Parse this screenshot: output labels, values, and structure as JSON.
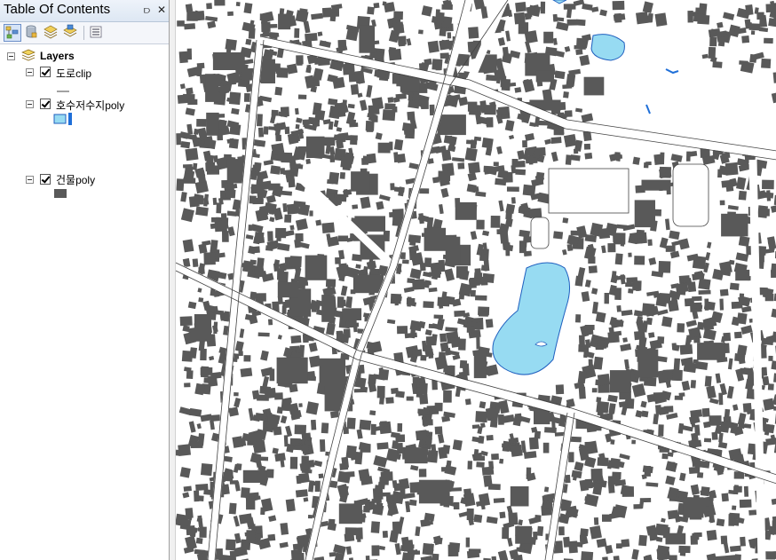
{
  "toc": {
    "title": "Table Of Contents",
    "pin_glyph": "⫐",
    "close_glyph": "✕",
    "toolbar_buttons": [
      {
        "name": "list-by-drawing-order-icon",
        "active": true
      },
      {
        "name": "list-by-source-icon",
        "active": false
      },
      {
        "name": "list-by-visibility-icon",
        "active": false
      },
      {
        "name": "list-by-selection-icon",
        "active": false
      },
      {
        "name": "options-icon",
        "active": false
      }
    ],
    "root_label": "Layers",
    "layers": [
      {
        "label": "도로clip",
        "checked": true,
        "symbol": "line"
      },
      {
        "label": "호수저수지poly",
        "checked": true,
        "symbol": "water"
      },
      {
        "label": "건물poly",
        "checked": true,
        "symbol": "building"
      }
    ]
  },
  "colors": {
    "building": "#595959",
    "water_fill": "#97dbf2",
    "water_outline": "#1f5fbf",
    "road": "#444444",
    "background": "#ffffff"
  }
}
